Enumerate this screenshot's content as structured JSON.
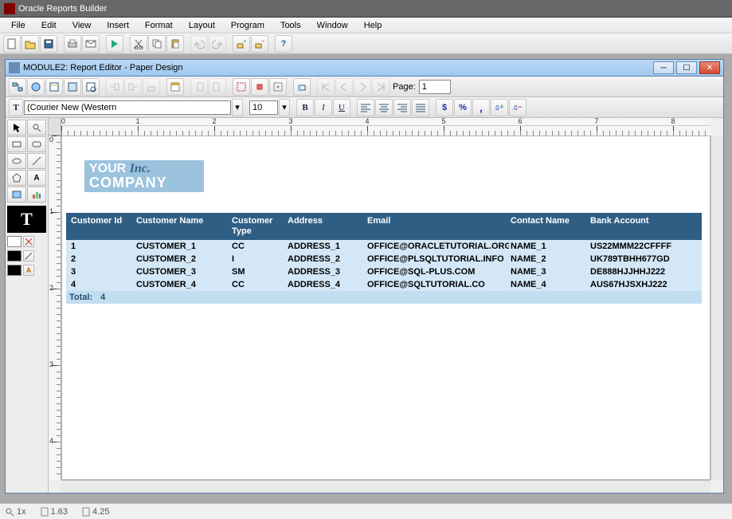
{
  "app": {
    "title": "Oracle Reports Builder"
  },
  "menu": [
    "File",
    "Edit",
    "View",
    "Insert",
    "Format",
    "Layout",
    "Program",
    "Tools",
    "Window",
    "Help"
  ],
  "child": {
    "title": "MODULE2: Report Editor - Paper Design"
  },
  "toolbar2": {
    "page_label": "Page:",
    "page_value": "1"
  },
  "fontbar": {
    "font": "(Courier New (Western",
    "size": "10",
    "bold": "B",
    "italic": "I",
    "underline": "U",
    "currency": "$",
    "percent": "%",
    "comma": ","
  },
  "ruler": {
    "h": [
      "0",
      "1",
      "2",
      "3",
      "4",
      "5",
      "6",
      "7",
      "8"
    ],
    "v": [
      "0",
      "1",
      "2",
      "3",
      "4"
    ]
  },
  "logo": {
    "l1a": "YOUR",
    "l1b": "Inc.",
    "l2": "COMPANY"
  },
  "headers": {
    "c1": "Customer Id",
    "c2": "Customer Name",
    "c3": "Customer Type",
    "c4": "Address",
    "c5": "Email",
    "c6": "Contact Name",
    "c7": "Bank Account"
  },
  "rows": [
    {
      "id": "1",
      "name": "CUSTOMER_1",
      "type": "CC",
      "addr": "ADDRESS_1",
      "email": "OFFICE@ORACLETUTORIAL.ORG",
      "contact": "NAME_1",
      "bank": "US22MMM22CFFFF"
    },
    {
      "id": "2",
      "name": "CUSTOMER_2",
      "type": "I",
      "addr": "ADDRESS_2",
      "email": "OFFICE@PLSQLTUTORIAL.INFO",
      "contact": "NAME_2",
      "bank": "UK789TBHH677GD"
    },
    {
      "id": "3",
      "name": "CUSTOMER_3",
      "type": "SM",
      "addr": "ADDRESS_3",
      "email": "OFFICE@SQL-PLUS.COM",
      "contact": "NAME_3",
      "bank": "DE888HJJHHJ222"
    },
    {
      "id": "4",
      "name": "CUSTOMER_4",
      "type": "CC",
      "addr": "ADDRESS_4",
      "email": "OFFICE@SQLTUTORIAL.CO",
      "contact": "NAME_4",
      "bank": "AUS67HJSXHJ222"
    }
  ],
  "total": {
    "label": "Total:",
    "value": "4"
  },
  "status": {
    "zoom": "1x",
    "x": "1.63",
    "y": "4.25"
  }
}
